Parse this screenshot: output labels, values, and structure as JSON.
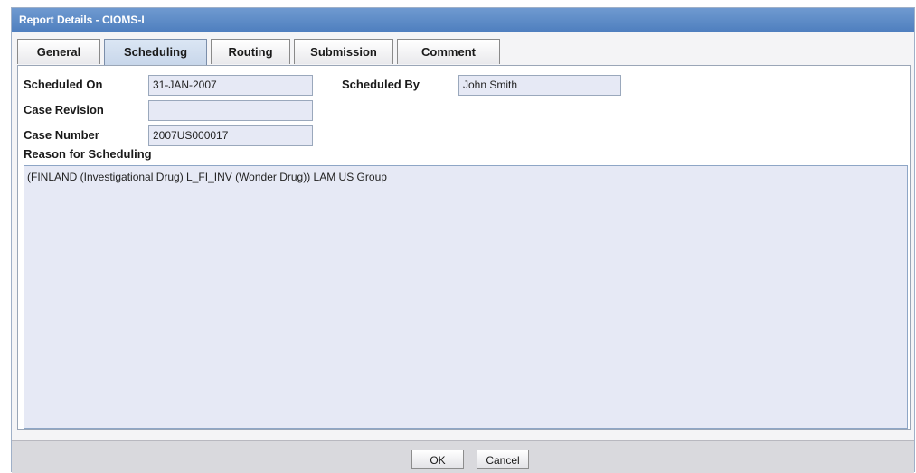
{
  "window": {
    "title": "Report Details - CIOMS-I"
  },
  "tabs": [
    {
      "label": "General"
    },
    {
      "label": "Scheduling"
    },
    {
      "label": "Routing"
    },
    {
      "label": "Submission"
    },
    {
      "label": "Comment"
    }
  ],
  "active_tab": "Scheduling",
  "form": {
    "scheduled_on": {
      "label": "Scheduled On",
      "value": "31-JAN-2007"
    },
    "scheduled_by": {
      "label": "Scheduled By",
      "value": "John Smith"
    },
    "case_revision": {
      "label": "Case Revision",
      "value": ""
    },
    "case_number": {
      "label": "Case Number",
      "value": "2007US000017"
    },
    "reason": {
      "label": "Reason for Scheduling",
      "value": "(FINLAND (Investigational Drug) L_FI_INV (Wonder Drug)) LAM US Group"
    }
  },
  "buttons": {
    "ok": "OK",
    "cancel": "Cancel"
  },
  "colors": {
    "title_bar": "#4f7fbf",
    "field_background": "#e6e9f5",
    "active_tab": "#c7d6ea"
  }
}
